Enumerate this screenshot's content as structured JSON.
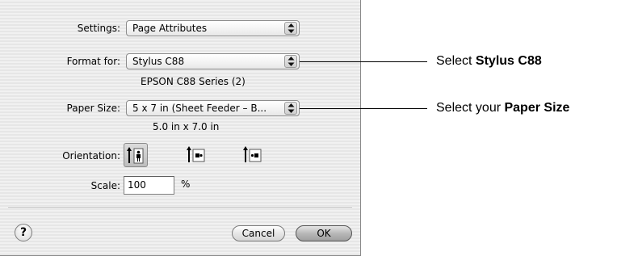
{
  "dialog": {
    "settings_label": "Settings:",
    "settings_value": "Page Attributes",
    "format_label": "Format for:",
    "format_value": "Stylus C88",
    "format_sub": "EPSON C88 Series (2)",
    "paper_label": "Paper Size:",
    "paper_value": "5 x 7 in (Sheet Feeder – B...",
    "paper_sub": "5.0 in x 7.0 in",
    "orientation_label": "Orientation:",
    "scale_label": "Scale:",
    "scale_value": "100",
    "scale_unit": "%",
    "help_label": "?",
    "cancel_label": "Cancel",
    "ok_label": "OK"
  },
  "callouts": {
    "printer_prefix": "Select ",
    "printer_bold": "Stylus C88",
    "paper_prefix": "Select your ",
    "paper_bold": "Paper Size"
  },
  "icons": {
    "popup_arrow": "up-down-arrows-icon",
    "orientation": [
      "portrait-orientation-icon",
      "landscape-left-orientation-icon",
      "landscape-right-orientation-icon"
    ]
  }
}
